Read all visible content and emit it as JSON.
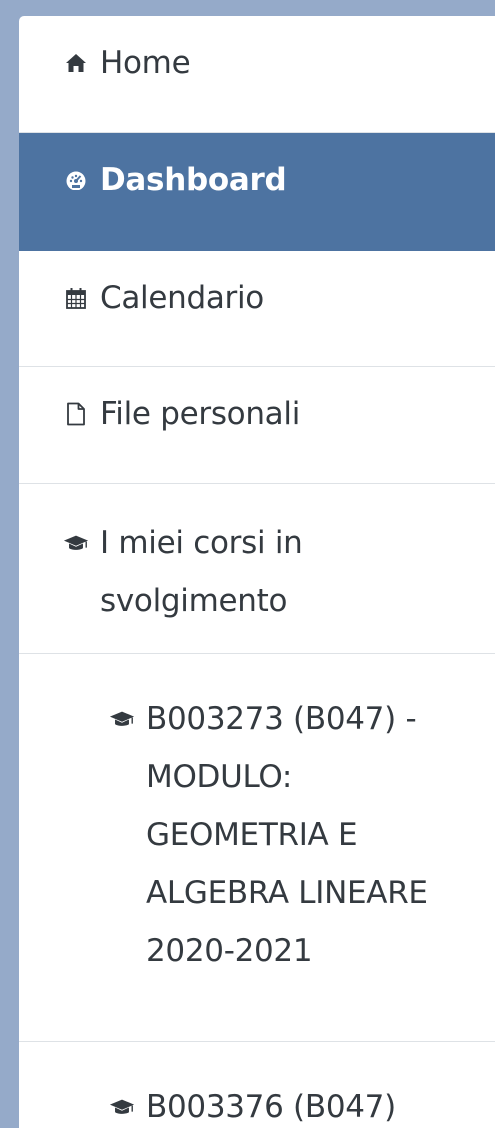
{
  "nav": {
    "home_label": "Home",
    "dashboard_label": "Dashboard",
    "calendar_label": "Calendario",
    "files_label": "File personali",
    "my_courses_label": "I miei corsi in svolgimento",
    "courses": [
      {
        "label": "B003273 (B047) - MODULO: GEOMETRIA E ALGEBRA LINEARE 2020-2021"
      },
      {
        "label": "B003376 (B047)"
      }
    ]
  },
  "icons": {
    "home": "home-icon",
    "dashboard": "dashboard-gauge-icon",
    "calendar": "calendar-icon",
    "files": "file-icon",
    "courses": "graduation-cap-icon"
  },
  "colors": {
    "active_background": "#4d73a1",
    "page_background": "#95aac9",
    "text": "#343a40"
  }
}
